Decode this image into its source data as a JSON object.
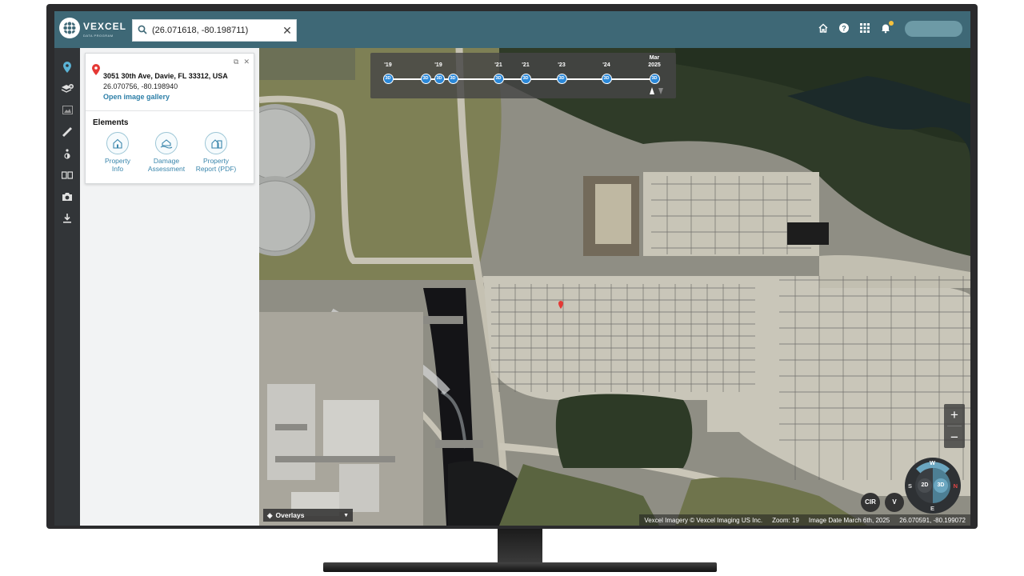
{
  "app": {
    "logo_text": "VEXCEL",
    "logo_subtext": "DATA PROGRAM"
  },
  "search": {
    "value": "(26.071618, -80.198711)",
    "clear_icon": "close-icon"
  },
  "top_icons": [
    "home-icon",
    "help-icon",
    "apps-grid-icon",
    "notifications-bell-icon"
  ],
  "rail": [
    "location-pin-icon",
    "layers-add-icon",
    "image-icon",
    "ruler-icon",
    "brightness-icon",
    "compare-icon",
    "camera-icon",
    "download-icon"
  ],
  "property": {
    "address": "3051 30th Ave, Davie, FL 33312, USA",
    "coordinates": "26.070756, -80.198940",
    "gallery_link": "Open image gallery"
  },
  "elements": {
    "title": "Elements",
    "items": [
      {
        "label_1": "Property",
        "label_2": "Info"
      },
      {
        "label_1": "Damage",
        "label_2": "Assessment"
      },
      {
        "label_1": "Property",
        "label_2": "Report (PDF)"
      }
    ]
  },
  "timeline": {
    "years": [
      "'19",
      "'19",
      "'21",
      "'21",
      "'23",
      "'24",
      "Mar",
      "2025"
    ],
    "dot_label": "3D"
  },
  "map_controls": {
    "zoom_in": "+",
    "zoom_out": "−",
    "compass_w": "W",
    "compass_n": "N",
    "compass_s": "S",
    "compass_e": "E",
    "mode_2d": "2D",
    "mode_3d": "3D",
    "cir": "CIR",
    "v": "V",
    "overlays": "Overlays"
  },
  "status": {
    "attribution": "Vexcel Imagery © Vexcel Imaging US Inc.",
    "zoom": "Zoom: 19",
    "image_date": "Image Date March 6th, 2025",
    "cursor_coords": "26.070591, -80.199072"
  },
  "colors": {
    "topbar": "#3e6876",
    "accent": "#2b88d8",
    "link": "#2d7fa8",
    "pin": "#e53935"
  }
}
